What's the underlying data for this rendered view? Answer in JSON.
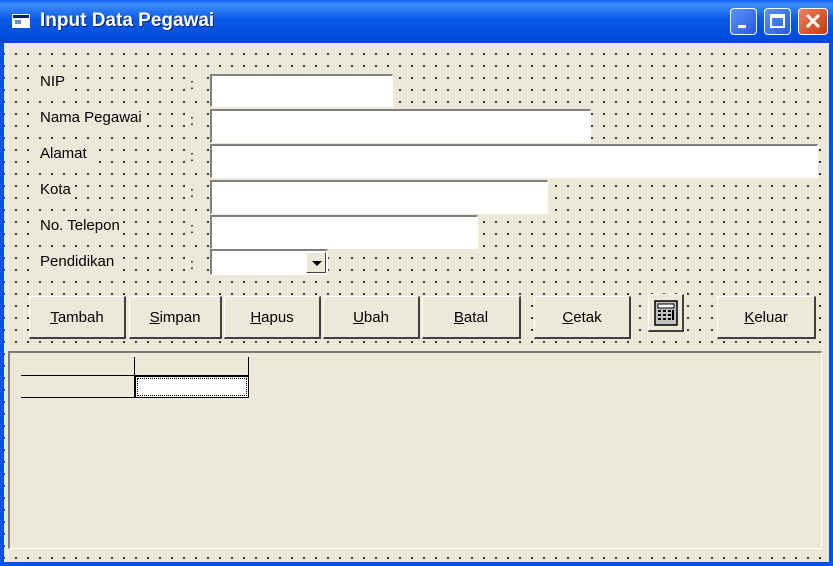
{
  "window": {
    "title": "Input Data Pegawai"
  },
  "form": {
    "fields": [
      {
        "label": "NIP",
        "colon": ":",
        "value": ""
      },
      {
        "label": "Nama Pegawai",
        "colon": ":",
        "value": ""
      },
      {
        "label": "Alamat",
        "colon": ":",
        "value": ""
      },
      {
        "label": "Kota",
        "colon": ":",
        "value": ""
      },
      {
        "label": "No. Telepon",
        "colon": ":",
        "value": ""
      },
      {
        "label": "Pendidikan",
        "colon": ":",
        "value": ""
      }
    ]
  },
  "buttons": [
    {
      "accel": "T",
      "rest": "ambah"
    },
    {
      "accel": "S",
      "rest": "impan"
    },
    {
      "accel": "H",
      "rest": "apus"
    },
    {
      "accel": "U",
      "rest": "bah"
    },
    {
      "accel": "B",
      "rest": "atal"
    },
    {
      "accel": "C",
      "rest": "etak"
    },
    {
      "accel": "K",
      "rest": "eluar"
    }
  ],
  "icons": {
    "calculator": "calculator-icon",
    "app": "app-icon"
  },
  "colors": {
    "titlebar": "#0054e3",
    "form_bg": "#ece9d8"
  }
}
